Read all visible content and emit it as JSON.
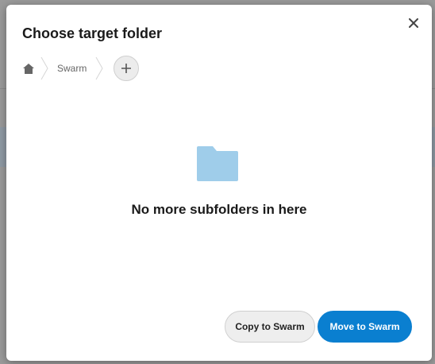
{
  "dialog": {
    "title": "Choose target folder",
    "close_icon": "close-icon"
  },
  "breadcrumb": {
    "home_icon": "home-icon",
    "items": [
      {
        "label": "Swarm"
      }
    ],
    "add_icon": "plus-icon"
  },
  "empty_state": {
    "icon": "folder-icon",
    "message": "No more subfolders in here"
  },
  "actions": {
    "copy_label": "Copy to Swarm",
    "move_label": "Move to Swarm"
  },
  "colors": {
    "primary": "#0a7fd0",
    "folder": "#9fcdea"
  }
}
